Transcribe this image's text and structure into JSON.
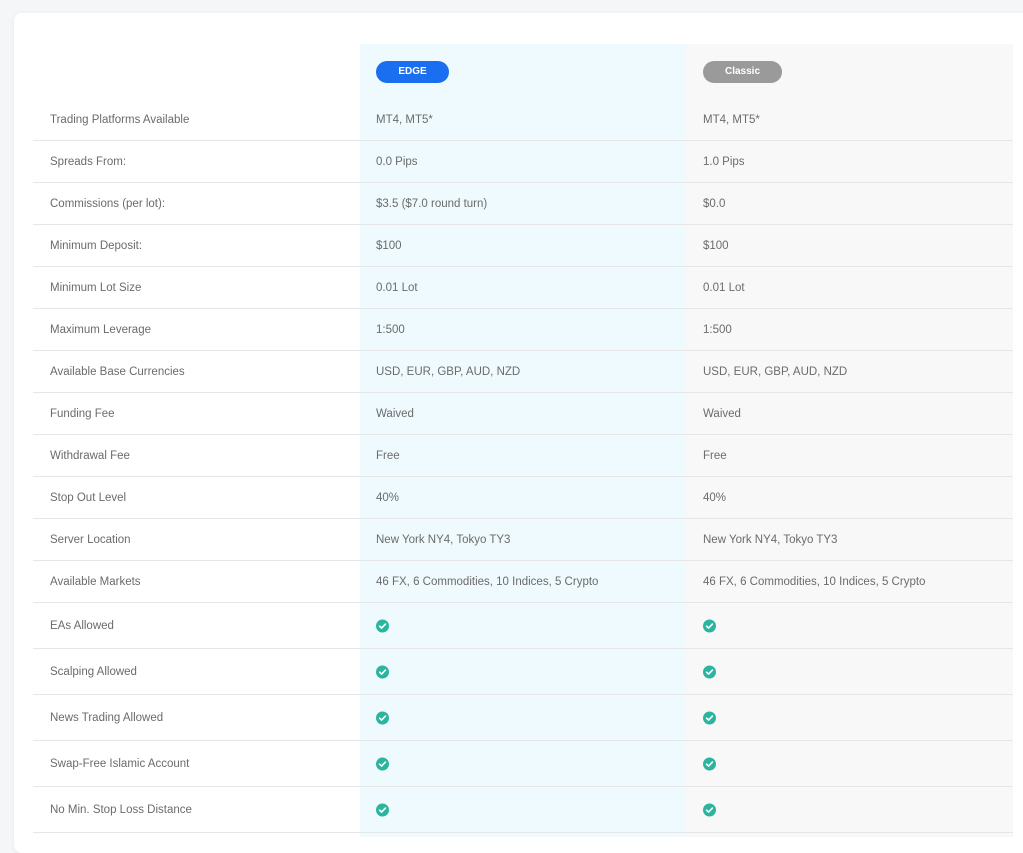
{
  "colors": {
    "edge_accent": "#1a6ef0",
    "classic_accent": "#9a9a9a",
    "check": "#2cb59e",
    "edge_column_bg": "#eefafd",
    "classic_column_bg": "#f8f8f8"
  },
  "plans": [
    {
      "label": "EDGE"
    },
    {
      "label": "Classic"
    }
  ],
  "rows": [
    {
      "label": "Trading Platforms Available",
      "edge": "MT4, MT5*",
      "classic": "MT4, MT5*"
    },
    {
      "label": "Spreads From:",
      "edge": "0.0 Pips",
      "classic": "1.0 Pips"
    },
    {
      "label": "Commissions (per lot):",
      "edge": "$3.5 ($7.0 round turn)",
      "classic": "$0.0"
    },
    {
      "label": "Minimum Deposit:",
      "edge": "$100",
      "classic": "$100"
    },
    {
      "label": "Minimum Lot Size",
      "edge": "0.01 Lot",
      "classic": "0.01 Lot"
    },
    {
      "label": "Maximum Leverage",
      "edge": "1:500",
      "classic": "1:500"
    },
    {
      "label": "Available Base Currencies",
      "edge": "USD, EUR, GBP, AUD, NZD",
      "classic": "USD, EUR, GBP, AUD, NZD"
    },
    {
      "label": "Funding Fee",
      "edge": "Waived",
      "classic": "Waived"
    },
    {
      "label": "Withdrawal Fee",
      "edge": "Free",
      "classic": "Free"
    },
    {
      "label": "Stop Out Level",
      "edge": "40%",
      "classic": "40%"
    },
    {
      "label": "Server Location",
      "edge": "New York NY4, Tokyo TY3",
      "classic": "New York NY4, Tokyo TY3"
    },
    {
      "label": "Available Markets",
      "edge": "46 FX, 6 Commodities, 10 Indices, 5 Crypto",
      "classic": "46 FX, 6 Commodities, 10 Indices, 5 Crypto"
    }
  ],
  "check_rows": [
    {
      "label": "EAs Allowed",
      "edge_icon": "check-circle-icon",
      "classic_icon": "check-circle-icon"
    },
    {
      "label": "Scalping Allowed",
      "edge_icon": "check-circle-icon",
      "classic_icon": "check-circle-icon"
    },
    {
      "label": "News Trading Allowed",
      "edge_icon": "check-circle-icon",
      "classic_icon": "check-circle-icon"
    },
    {
      "label": "Swap-Free Islamic Account",
      "edge_icon": "check-circle-icon",
      "classic_icon": "check-circle-icon"
    },
    {
      "label": "No Min. Stop Loss Distance",
      "edge_icon": "check-circle-icon",
      "classic_icon": "check-circle-icon"
    }
  ]
}
